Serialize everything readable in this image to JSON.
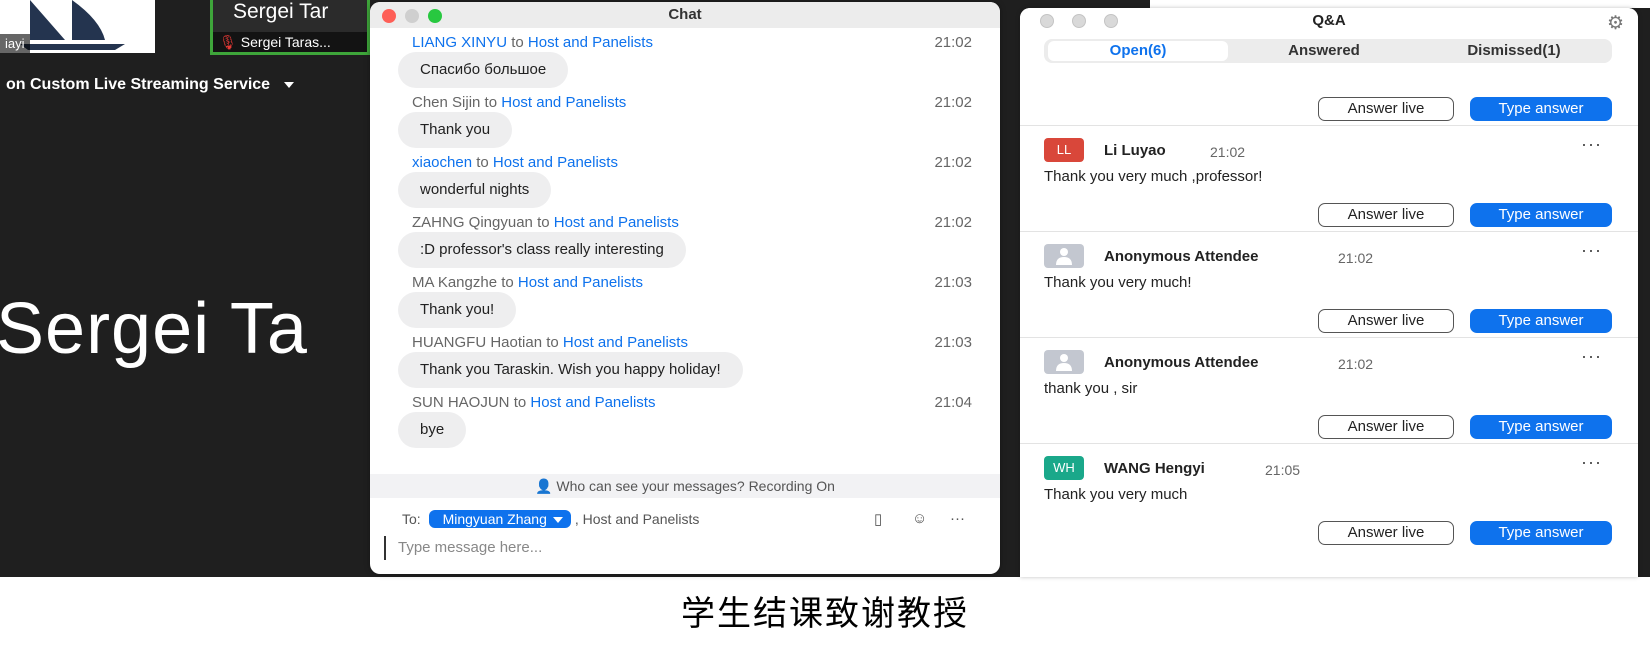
{
  "meeting": {
    "thumb1_name": "iayi",
    "thumb2_big": "Sergei Tar",
    "thumb2_name": "Sergei Taras...",
    "stream_label": "on Custom Live Streaming Service",
    "big_name": "Sergei Ta"
  },
  "chat": {
    "title": "Chat",
    "messages": [
      {
        "from": "LIANG XINYU",
        "to_word": "to",
        "to": "Host and Panelists",
        "time": "21:02",
        "text": "Спасибо большое"
      },
      {
        "from": "Chen Sijin",
        "to_word": "to",
        "to": "Host and Panelists",
        "time": "21:02",
        "text": "Thank you"
      },
      {
        "from": "xiaochen",
        "to_word": "to",
        "to": "Host and Panelists",
        "time": "21:02",
        "text": "wonderful nights"
      },
      {
        "from": "ZAHNG Qingyuan",
        "to_word": "to",
        "to": "Host and Panelists",
        "time": "21:02",
        "text": ":D professor's class really interesting"
      },
      {
        "from": "MA Kangzhe",
        "to_word": "to",
        "to": "Host and Panelists",
        "time": "21:03",
        "text": "Thank you!"
      },
      {
        "from": "HUANGFU Haotian",
        "to_word": "to",
        "to": "Host and Panelists",
        "time": "21:03",
        "text": "Thank you Taraskin. Wish you happy holiday!"
      },
      {
        "from": "SUN HAOJUN",
        "to_word": "to",
        "to": "Host and Panelists",
        "time": "21:04",
        "text": "bye"
      }
    ],
    "privacy_text": "Who can see your messages? Recording On",
    "to_label": "To:",
    "to_recipient": "Mingyuan Zhang",
    "to_extra": ", Host and Panelists",
    "input_placeholder": "Type message here..."
  },
  "qa": {
    "title": "Q&A",
    "tabs": [
      "Open(6)",
      "Answered",
      "Dismissed(1)"
    ],
    "answer_live_label": "Answer live",
    "type_answer_label": "Type answer",
    "questions": [
      {
        "avatar": "LL",
        "avatar_color": "#d9473a",
        "name": "Li Luyao",
        "time": "21:02",
        "text": "Thank you very much ,professor!"
      },
      {
        "avatar": "",
        "avatar_color": "#c3c7d0",
        "name": "Anonymous Attendee",
        "time": "21:02",
        "text": "Thank you very much!"
      },
      {
        "avatar": "",
        "avatar_color": "#c3c7d0",
        "name": "Anonymous Attendee",
        "time": "21:02",
        "text": "thank you ,   sir"
      },
      {
        "avatar": "WH",
        "avatar_color": "#1aa88a",
        "name": "WANG Hengyi",
        "time": "21:05",
        "text": "Thank you very much"
      }
    ]
  },
  "caption": "学生结课致谢教授",
  "colors": {
    "accent_blue": "#0e72ed",
    "meeting_bg": "#1f1f1f",
    "active_speaker_border": "#3ea53a"
  }
}
